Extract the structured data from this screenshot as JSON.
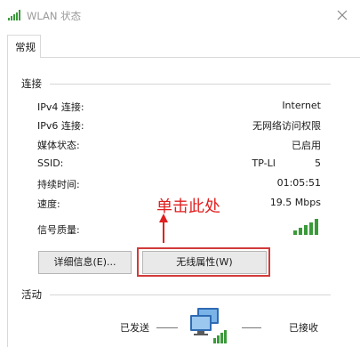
{
  "window": {
    "title": "WLAN 状态",
    "close_icon": "close-icon",
    "title_icon": "wlan-signal-icon"
  },
  "tabs": [
    {
      "label": "常规"
    }
  ],
  "connection": {
    "section_title": "连接",
    "rows": [
      {
        "label": "IPv4 连接:",
        "value": "Internet"
      },
      {
        "label": "IPv6 连接:",
        "value": "无网络访问权限"
      },
      {
        "label": "媒体状态:",
        "value": "已启用"
      },
      {
        "label": "SSID:",
        "value": "TP-LI",
        "value_suffix": "5"
      },
      {
        "label": "持续时间:",
        "value": "01:05:51"
      },
      {
        "label": "速度:",
        "value": "19.5 Mbps"
      },
      {
        "label": "信号质量:",
        "value_icon": "signal-strength-icon",
        "signal_level": 1.0
      }
    ]
  },
  "buttons": {
    "details_label": "详细信息(E)...",
    "wireless_props_label": "无线属性(W)"
  },
  "annotation": {
    "text": "单击此处",
    "color": "#e02020"
  },
  "activity": {
    "section_title": "活动",
    "sent_label": "已发送",
    "received_label": "已接收",
    "icon": "network-computer-icon"
  },
  "colors": {
    "signal_green": "#3a9a3a",
    "highlight_red": "#d23a3a"
  }
}
